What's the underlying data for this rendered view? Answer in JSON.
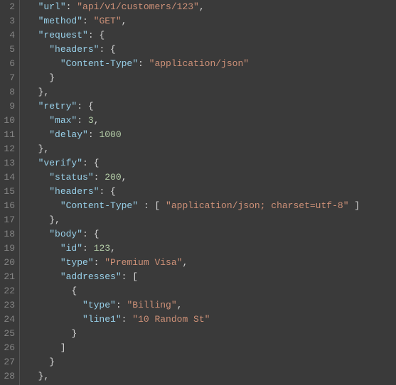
{
  "lines": [
    {
      "num": 2,
      "tokens": [
        [
          "p",
          "  "
        ],
        [
          "k",
          "\"url\""
        ],
        [
          "p",
          ": "
        ],
        [
          "s",
          "\"api/v1/customers/123\""
        ],
        [
          "p",
          ","
        ]
      ]
    },
    {
      "num": 3,
      "tokens": [
        [
          "p",
          "  "
        ],
        [
          "k",
          "\"method\""
        ],
        [
          "p",
          ": "
        ],
        [
          "s",
          "\"GET\""
        ],
        [
          "p",
          ","
        ]
      ]
    },
    {
      "num": 4,
      "tokens": [
        [
          "p",
          "  "
        ],
        [
          "k",
          "\"request\""
        ],
        [
          "p",
          ": {"
        ]
      ]
    },
    {
      "num": 5,
      "tokens": [
        [
          "p",
          "    "
        ],
        [
          "k",
          "\"headers\""
        ],
        [
          "p",
          ": {"
        ]
      ]
    },
    {
      "num": 6,
      "tokens": [
        [
          "p",
          "      "
        ],
        [
          "k",
          "\"Content-Type\""
        ],
        [
          "p",
          ": "
        ],
        [
          "s",
          "\"application/json\""
        ]
      ]
    },
    {
      "num": 7,
      "tokens": [
        [
          "p",
          "    }"
        ]
      ]
    },
    {
      "num": 8,
      "tokens": [
        [
          "p",
          "  },"
        ]
      ]
    },
    {
      "num": 9,
      "tokens": [
        [
          "p",
          "  "
        ],
        [
          "k",
          "\"retry\""
        ],
        [
          "p",
          ": {"
        ]
      ]
    },
    {
      "num": 10,
      "tokens": [
        [
          "p",
          "    "
        ],
        [
          "k",
          "\"max\""
        ],
        [
          "p",
          ": "
        ],
        [
          "n",
          "3"
        ],
        [
          "p",
          ","
        ]
      ]
    },
    {
      "num": 11,
      "tokens": [
        [
          "p",
          "    "
        ],
        [
          "k",
          "\"delay\""
        ],
        [
          "p",
          ": "
        ],
        [
          "n",
          "1000"
        ]
      ]
    },
    {
      "num": 12,
      "tokens": [
        [
          "p",
          "  },"
        ]
      ]
    },
    {
      "num": 13,
      "tokens": [
        [
          "p",
          "  "
        ],
        [
          "k",
          "\"verify\""
        ],
        [
          "p",
          ": {"
        ]
      ]
    },
    {
      "num": 14,
      "tokens": [
        [
          "p",
          "    "
        ],
        [
          "k",
          "\"status\""
        ],
        [
          "p",
          ": "
        ],
        [
          "n",
          "200"
        ],
        [
          "p",
          ","
        ]
      ]
    },
    {
      "num": 15,
      "tokens": [
        [
          "p",
          "    "
        ],
        [
          "k",
          "\"headers\""
        ],
        [
          "p",
          ": {"
        ]
      ]
    },
    {
      "num": 16,
      "tokens": [
        [
          "p",
          "      "
        ],
        [
          "k",
          "\"Content-Type\""
        ],
        [
          "p",
          " : [ "
        ],
        [
          "s",
          "\"application/json; charset=utf-8\""
        ],
        [
          "p",
          " ]"
        ]
      ]
    },
    {
      "num": 17,
      "tokens": [
        [
          "p",
          "    },"
        ]
      ]
    },
    {
      "num": 18,
      "tokens": [
        [
          "p",
          "    "
        ],
        [
          "k",
          "\"body\""
        ],
        [
          "p",
          ": {"
        ]
      ]
    },
    {
      "num": 19,
      "tokens": [
        [
          "p",
          "      "
        ],
        [
          "k",
          "\"id\""
        ],
        [
          "p",
          ": "
        ],
        [
          "n",
          "123"
        ],
        [
          "p",
          ","
        ]
      ]
    },
    {
      "num": 20,
      "tokens": [
        [
          "p",
          "      "
        ],
        [
          "k",
          "\"type\""
        ],
        [
          "p",
          ": "
        ],
        [
          "s",
          "\"Premium Visa\""
        ],
        [
          "p",
          ","
        ]
      ]
    },
    {
      "num": 21,
      "tokens": [
        [
          "p",
          "      "
        ],
        [
          "k",
          "\"addresses\""
        ],
        [
          "p",
          ": ["
        ]
      ]
    },
    {
      "num": 22,
      "tokens": [
        [
          "p",
          "        {"
        ]
      ]
    },
    {
      "num": 23,
      "tokens": [
        [
          "p",
          "          "
        ],
        [
          "k",
          "\"type\""
        ],
        [
          "p",
          ": "
        ],
        [
          "s",
          "\"Billing\""
        ],
        [
          "p",
          ","
        ]
      ]
    },
    {
      "num": 24,
      "tokens": [
        [
          "p",
          "          "
        ],
        [
          "k",
          "\"line1\""
        ],
        [
          "p",
          ": "
        ],
        [
          "s",
          "\"10 Random St\""
        ]
      ]
    },
    {
      "num": 25,
      "tokens": [
        [
          "p",
          "        }"
        ]
      ]
    },
    {
      "num": 26,
      "tokens": [
        [
          "p",
          "      ]"
        ]
      ]
    },
    {
      "num": 27,
      "tokens": [
        [
          "p",
          "    }"
        ]
      ]
    },
    {
      "num": 28,
      "tokens": [
        [
          "p",
          "  },"
        ]
      ]
    }
  ]
}
